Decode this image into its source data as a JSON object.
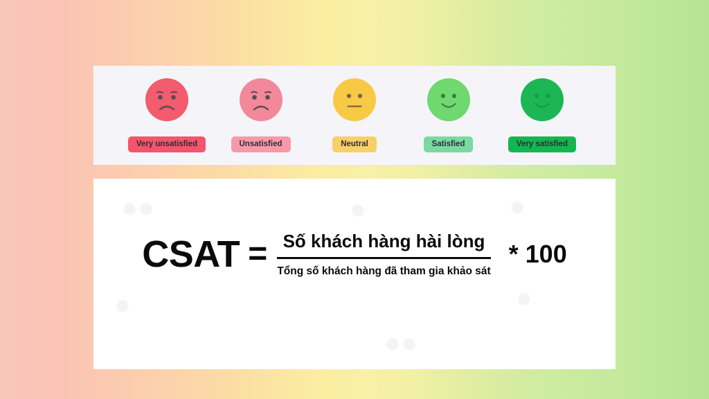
{
  "background": {
    "gradient_from": "#f9c6bc",
    "gradient_mid": "#f8f0a6",
    "gradient_to": "#b6e493"
  },
  "scale_card": {
    "background": "#f5f5f9",
    "items": [
      {
        "label": "Very unsatisfied",
        "icon": "frowning-face-icon",
        "face_color": "#f25c6e",
        "feature_color": "#5c4a52",
        "pill_color": "#f4546c",
        "expression": "frown-with-eyebrows"
      },
      {
        "label": "Unsatisfied",
        "icon": "slightly-frowning-face-icon",
        "face_color": "#f2899a",
        "feature_color": "#5c4a52",
        "pill_color": "#f79aa8",
        "expression": "frown-with-eyebrows"
      },
      {
        "label": "Neutral",
        "icon": "neutral-face-icon",
        "face_color": "#f8c council",
        "feature_color": "#7a6540",
        "pill_color": "#f9cf6a",
        "expression": "flat-mouth"
      },
      {
        "label": "Satisfied",
        "icon": "slightly-smiling-face-icon",
        "face_color": "#6fd86f",
        "feature_color": "#3f7a47",
        "pill_color": "#79d9a0",
        "expression": "smile"
      },
      {
        "label": "Very satisfied",
        "icon": "smiling-face-icon",
        "face_color": "#1cb754",
        "feature_color": "#169a46",
        "pill_color": "#12b74f",
        "expression": "smile"
      }
    ]
  },
  "formula_card": {
    "background": "#ffffff",
    "metric_name": "CSAT",
    "equals": "=",
    "numerator": "Số khách hàng hài lòng",
    "denominator": "Tổng số khách hàng đã tham gia khảo sát",
    "multiplier": "* 100"
  }
}
